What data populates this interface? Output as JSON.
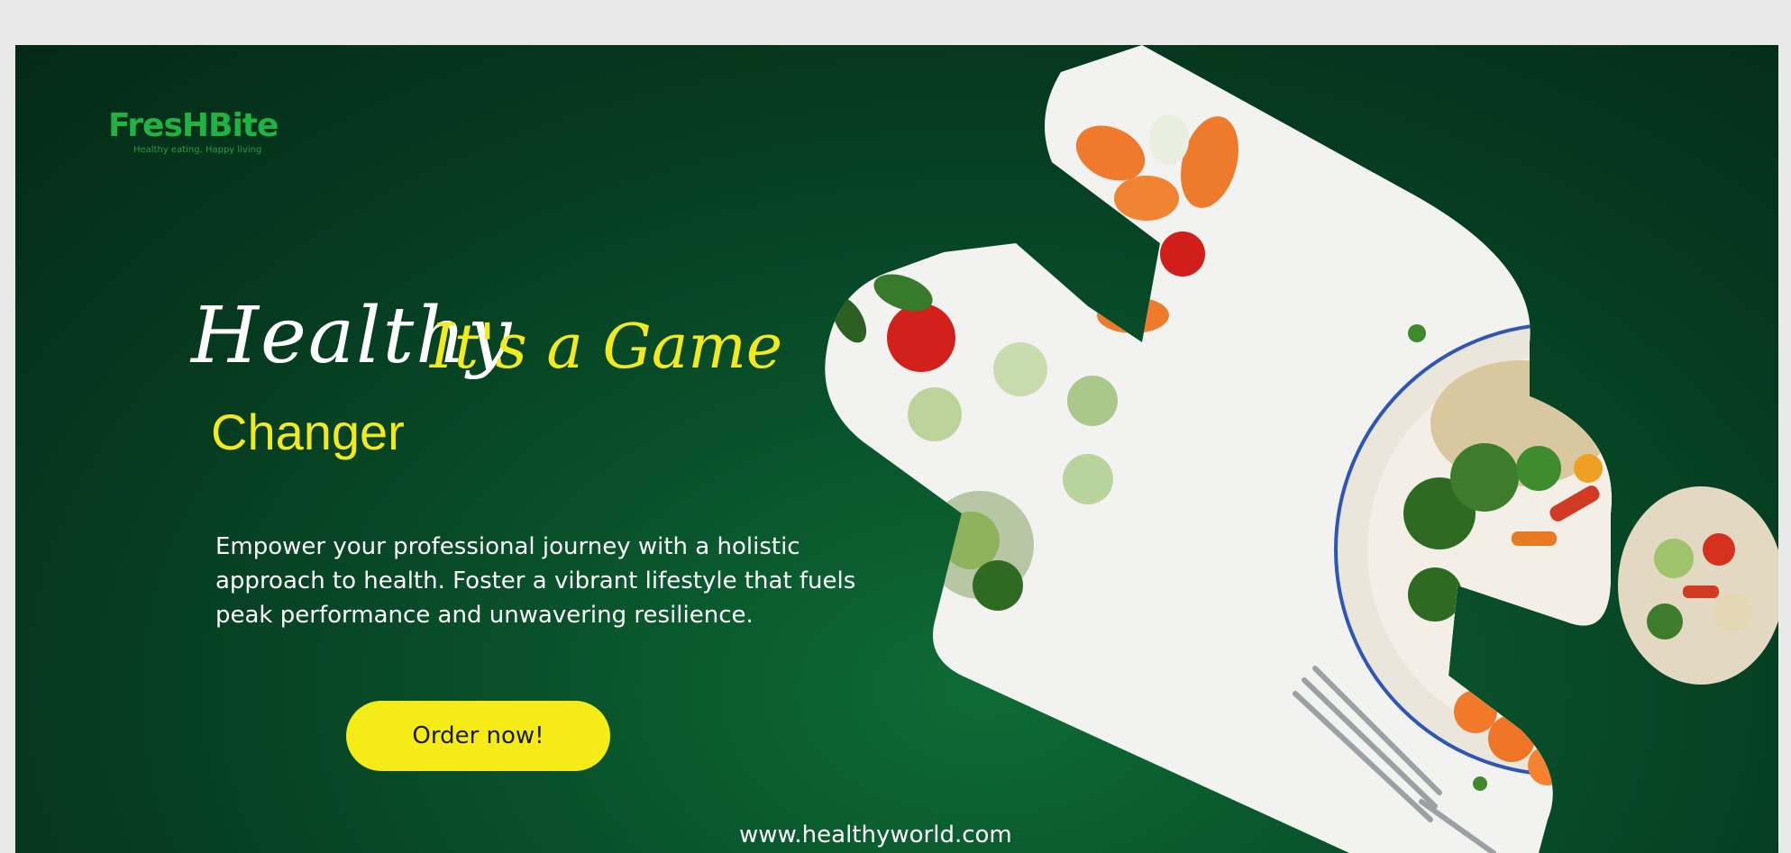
{
  "logo": {
    "title": "FresHBite",
    "tagline": "Healthy eating, Happy living"
  },
  "headline": {
    "word1": "Healthy",
    "word2": "It's a Game",
    "word3": "Changer"
  },
  "body": "Empower your professional journey with a holistic approach to health. Foster a vibrant lifestyle that fuels peak performance and unwavering resilience.",
  "cta": {
    "label": "Order now!"
  },
  "website": "www.healthyworld.com",
  "colors": {
    "accent": "#f5ec17",
    "brand": "#1fb344",
    "background": "#08502a"
  }
}
